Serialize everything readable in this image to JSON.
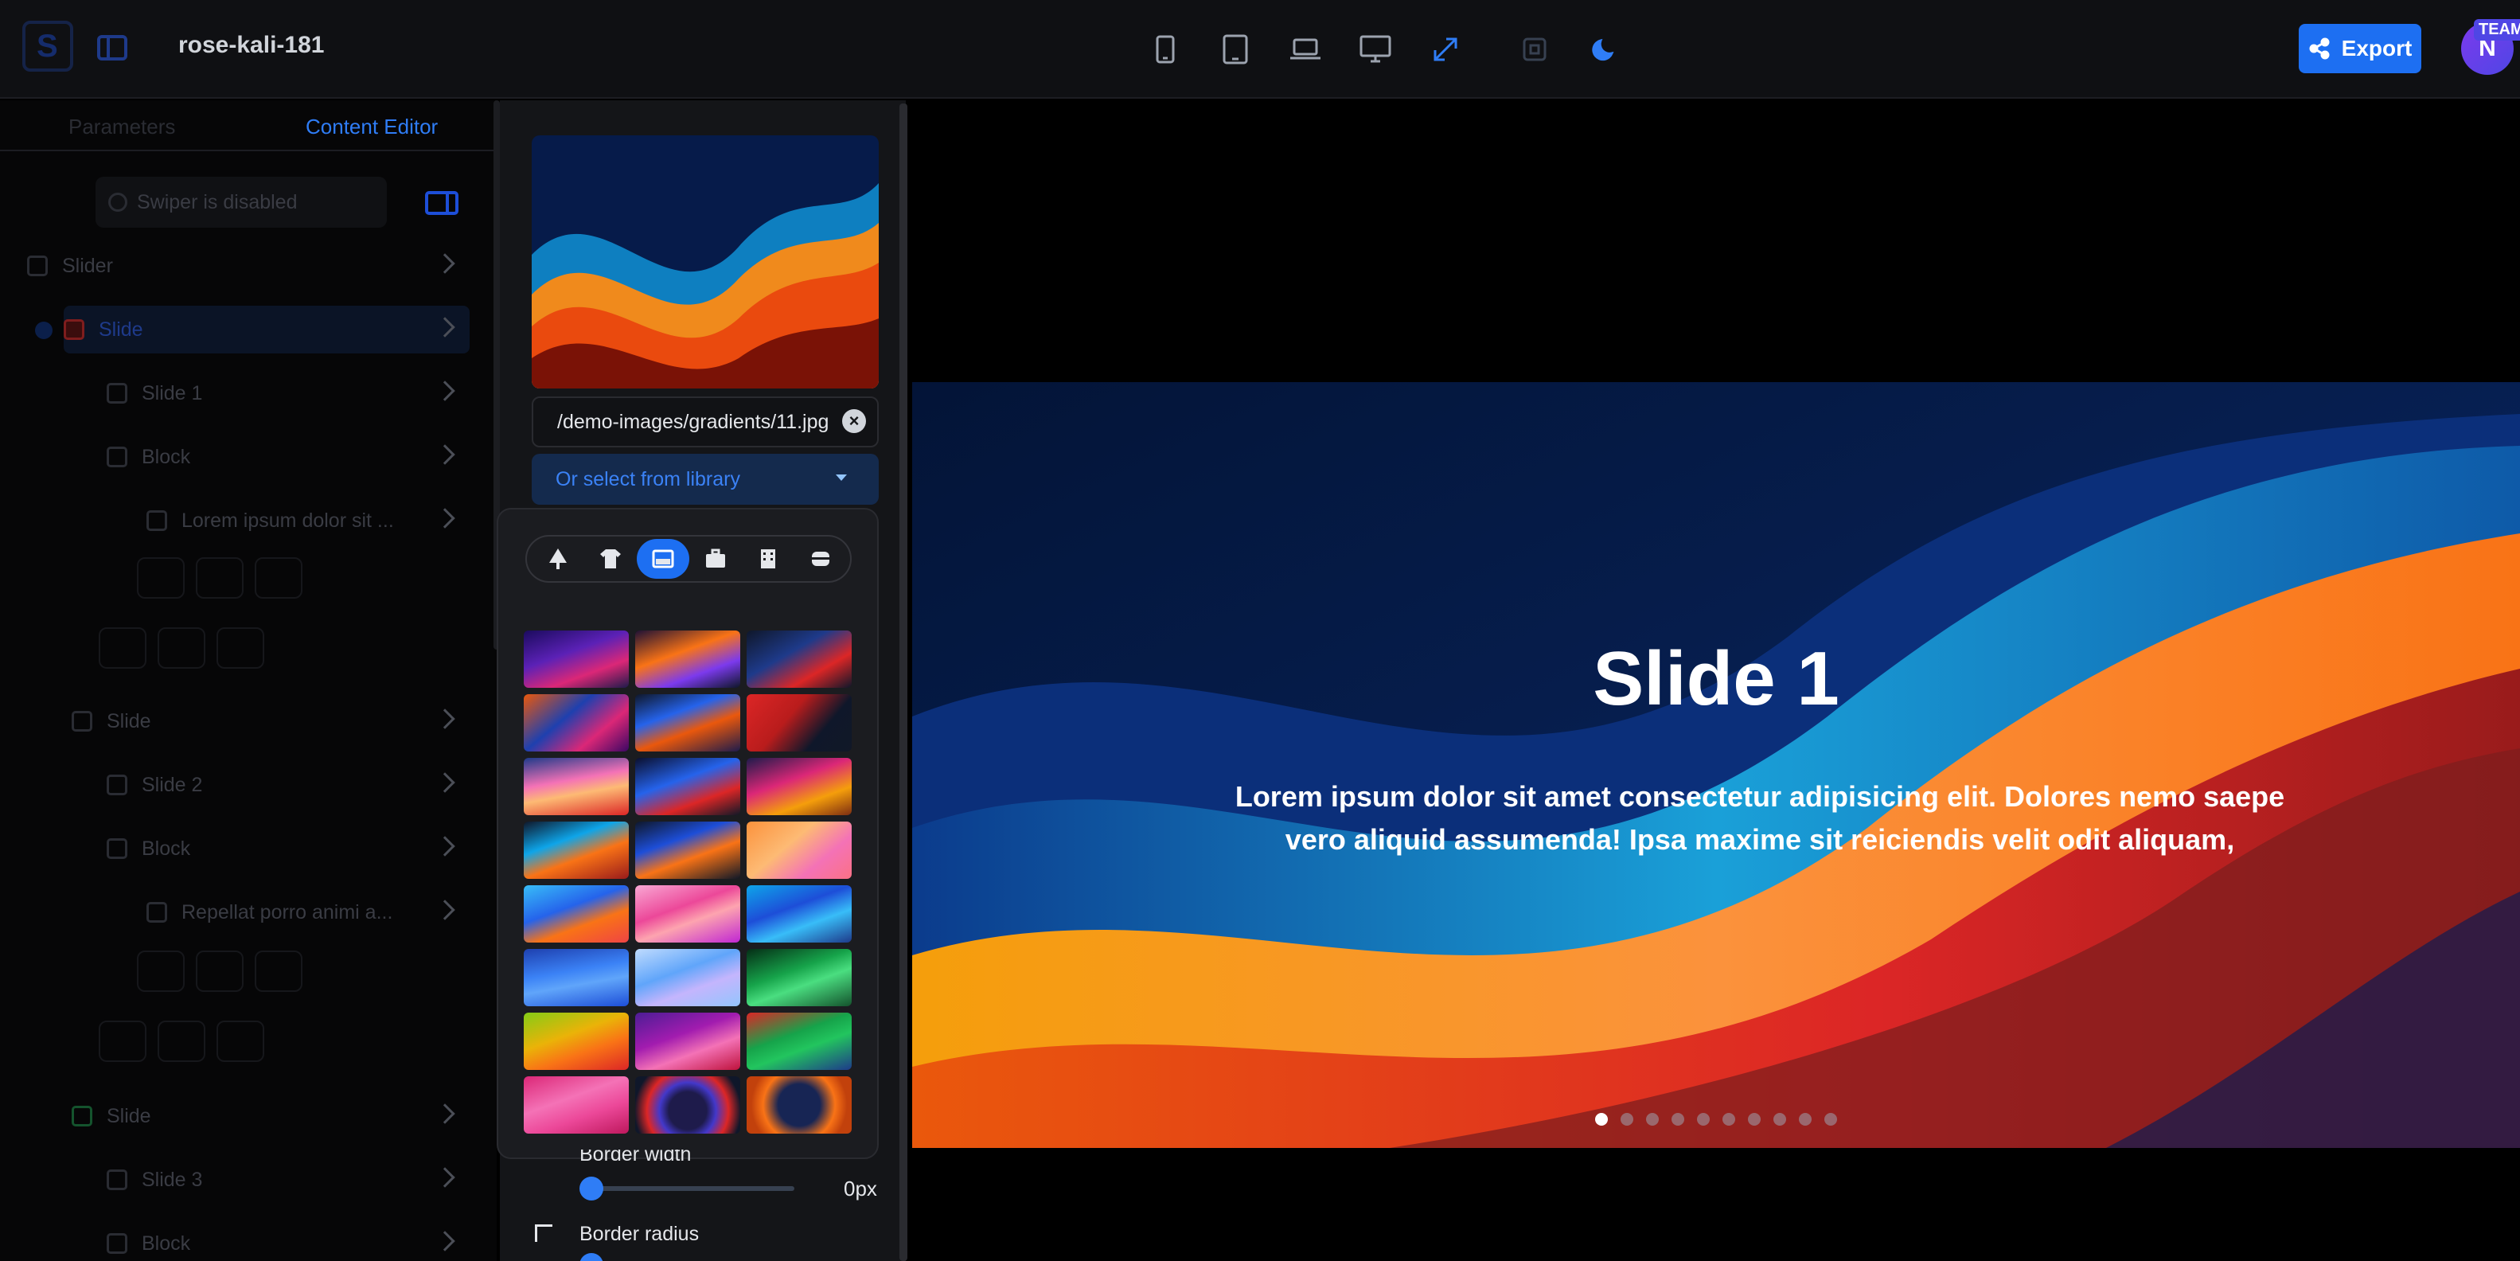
{
  "header": {
    "project_name": "rose-kali-181",
    "export_label": "Export",
    "avatar_initial": "N",
    "team_badge": "TEAM",
    "accent_color": "#1d6ff2"
  },
  "sidebar": {
    "tabs": [
      "Parameters",
      "Content Editor"
    ],
    "active_tab": "Content Editor",
    "swiper_status": "Swiper is disabled",
    "tree": [
      {
        "label": "Slider",
        "icon": "slider-icon"
      },
      {
        "label": "Slide",
        "icon": "image-icon",
        "selected": true
      },
      {
        "label": "Slide 1",
        "icon": "text-icon"
      },
      {
        "label": "Block",
        "icon": "block-icon"
      },
      {
        "label": "Lorem ipsum dolor sit ...",
        "icon": "text-icon"
      },
      {
        "label": "Slide",
        "icon": "image-icon"
      },
      {
        "label": "Slide 2",
        "icon": "text-icon"
      },
      {
        "label": "Block",
        "icon": "block-icon"
      },
      {
        "label": "Repellat porro animi a...",
        "icon": "text-icon"
      },
      {
        "label": "Slide",
        "icon": "image-icon"
      },
      {
        "label": "Slide 3",
        "icon": "text-icon"
      },
      {
        "label": "Block",
        "icon": "block-icon"
      }
    ]
  },
  "editor": {
    "image_path": "/demo-images/gradients/11.jpg",
    "library_button": "Or select from library",
    "categories": [
      "tree-icon",
      "shirt-icon",
      "gradient-icon",
      "briefcase-icon",
      "building-icon",
      "food-icon"
    ],
    "active_category": "gradient-icon",
    "thumbnail_count": 24,
    "border_width_label": "Border width",
    "border_width_value": "0px",
    "border_radius_label": "Border radius"
  },
  "slide": {
    "title": "Slide 1",
    "text": "Lorem ipsum dolor sit amet consectetur adipisicing elit. Dolores nemo saepe vero aliquid assumenda! Ipsa maxime sit reiciendis velit odit aliquam,",
    "page_count": 10,
    "active_page": 1
  }
}
